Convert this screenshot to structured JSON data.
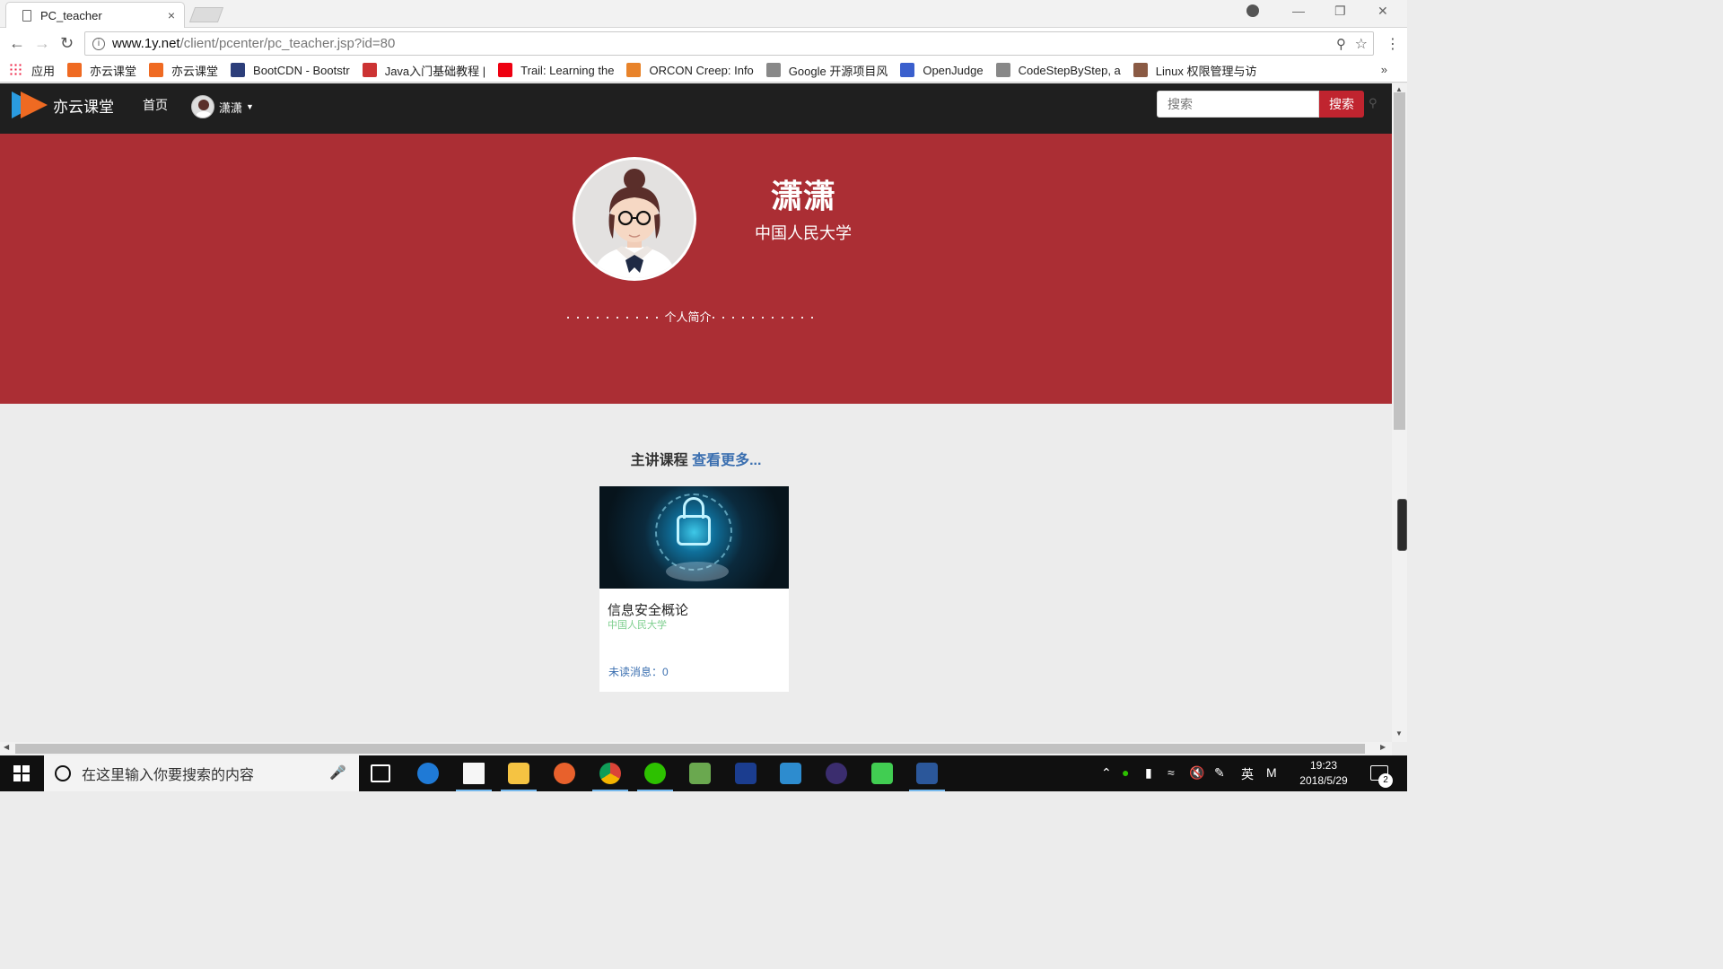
{
  "browser": {
    "tab_title": "PC_teacher",
    "tab_close": "×",
    "url_host": "www.1y.net",
    "url_path": "/client/pcenter/pc_teacher.jsp?id=80",
    "bookmarks": [
      {
        "label": "应用",
        "icon": "apps-grid-icon",
        "color": "#e24"
      },
      {
        "label": "亦云课堂",
        "icon": "yiyun-logo-icon",
        "color": "#ef6a22"
      },
      {
        "label": "亦云课堂",
        "icon": "yiyun-logo-icon",
        "color": "#ef6a22"
      },
      {
        "label": "BootCDN - Bootstr",
        "icon": "bootcdn-icon",
        "color": "#2c3e7a"
      },
      {
        "label": "Java入门基础教程 |",
        "icon": "runoob-icon",
        "color": "#c33"
      },
      {
        "label": "Trail: Learning the",
        "icon": "oracle-icon",
        "color": "#e01"
      },
      {
        "label": "ORCON Creep: Info",
        "icon": "letter-e-icon",
        "color": "#e8832a"
      },
      {
        "label": "Google 开源项目风",
        "icon": "page-icon",
        "color": "#888"
      },
      {
        "label": "OpenJudge",
        "icon": "poj-icon",
        "color": "#3a5fcd"
      },
      {
        "label": "CodeStepByStep, a",
        "icon": "page-icon",
        "color": "#888"
      },
      {
        "label": "Linux 权限管理与访",
        "icon": "linux-site-icon",
        "color": "#8a5a44"
      }
    ],
    "more_bookmarks": "»"
  },
  "site": {
    "logo_text": "亦云课堂",
    "nav_home": "首页",
    "user_name": "潇潇",
    "search_placeholder": "搜索",
    "search_button": "搜索",
    "accent_color": "#ab2e34"
  },
  "profile": {
    "name": "潇潇",
    "school": "中国人民大学",
    "intro_label": "个人简介",
    "intro_dots_left": "..........",
    "intro_dots_right": "..........."
  },
  "courses_section": {
    "title": "主讲课程",
    "more_link": "查看更多...",
    "courses": [
      {
        "name": "信息安全概论",
        "school": "中国人民大学",
        "unread_label": "未读消息：",
        "unread_count": "0"
      }
    ]
  },
  "taskbar": {
    "search_placeholder": "在这里输入你要搜索的内容",
    "ime_lang": "英",
    "ime_mode": "M",
    "time": "19:23",
    "date": "2018/5/29",
    "notification_count": "2"
  }
}
